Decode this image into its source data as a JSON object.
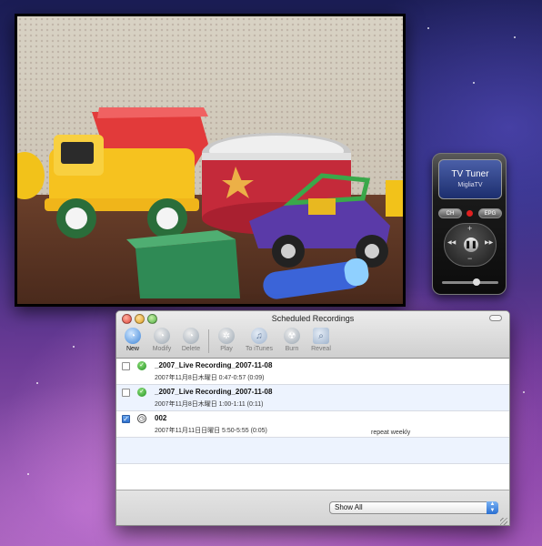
{
  "remote": {
    "title": "TV Tuner",
    "subtitle": "MigliaTV",
    "ch_label": "CH",
    "epg_label": "EPG",
    "plus": "+",
    "minus": "−",
    "play_pause": "❚❚",
    "rewind": "◀◀",
    "forward": "▶▶"
  },
  "window": {
    "title": "Scheduled Recordings",
    "toolbar": [
      {
        "label": "New",
        "icon": "new-recording-icon",
        "enabled": true
      },
      {
        "label": "Modify",
        "icon": "modify-recording-icon",
        "enabled": false
      },
      {
        "label": "Delete",
        "icon": "delete-recording-icon",
        "enabled": false
      },
      {
        "label": "Play",
        "icon": "film-reel-icon",
        "enabled": false
      },
      {
        "label": "To iTunes",
        "icon": "music-note-icon",
        "enabled": false
      },
      {
        "label": "Burn",
        "icon": "burn-disc-icon",
        "enabled": false
      },
      {
        "label": "Reveal",
        "icon": "reveal-icon",
        "enabled": false
      }
    ],
    "recordings": [
      {
        "checked": false,
        "status": "completed",
        "title": "_2007_Live Recording_2007-11-08",
        "time": "2007年11月8日木曜日  0:47-0:57 (0:09)",
        "note": ""
      },
      {
        "checked": false,
        "status": "completed",
        "title": "_2007_Live Recording_2007-11-08",
        "time": "2007年11月8日木曜日  1:00-1:11 (0:11)",
        "note": ""
      },
      {
        "checked": true,
        "status": "scheduled",
        "title": "002",
        "time": "2007年11月11日日曜日  5:50-5:55 (0:05)",
        "note": "repeat weekly"
      }
    ],
    "filter": {
      "selected": "Show All"
    }
  }
}
